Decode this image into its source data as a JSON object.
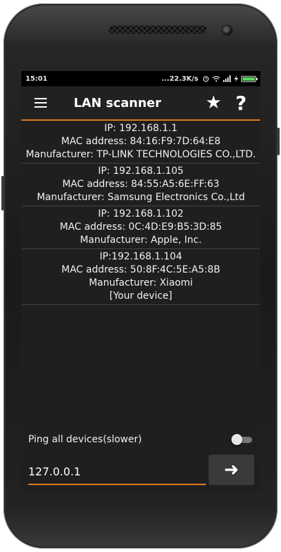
{
  "statusbar": {
    "time": "15:01",
    "network_speed": "...22.3K/s",
    "battery_color": "#5fd35f"
  },
  "appbar": {
    "title": "LAN scanner",
    "menu_icon": "hamburger-menu-icon",
    "favorite_icon": "star-icon",
    "favorite_glyph": "★",
    "help_icon": "help-icon",
    "help_glyph": "?"
  },
  "devices": [
    {
      "ip": "IP: 192.168.1.1",
      "mac": "MAC address: 84:16:F9:7D:64:E8",
      "manufacturer": "Manufacturer:  TP-LINK TECHNOLOGIES CO.,LTD.",
      "note": ""
    },
    {
      "ip": "IP: 192.168.1.105",
      "mac": "MAC address: 84:55:A5:6E:FF:63",
      "manufacturer": "Manufacturer:  Samsung Electronics Co.,Ltd",
      "note": ""
    },
    {
      "ip": "IP: 192.168.1.102",
      "mac": "MAC address: 0C:4D:E9:B5:3D:85",
      "manufacturer": "Manufacturer:  Apple, Inc.",
      "note": ""
    },
    {
      "ip": "IP:192.168.1.104",
      "mac": "MAC address: 50:8F:4C:5E:A5:8B",
      "manufacturer": "Manufacturer: Xiaomi",
      "note": "[Your device]"
    }
  ],
  "ping": {
    "label": "Ping all devices(slower)",
    "enabled": false
  },
  "input": {
    "value": "127.0.0.1",
    "go_icon": "arrow-right-icon",
    "go_glyph": "➜"
  },
  "colors": {
    "accent": "#e07b1f",
    "background": "#1f1f1f"
  }
}
